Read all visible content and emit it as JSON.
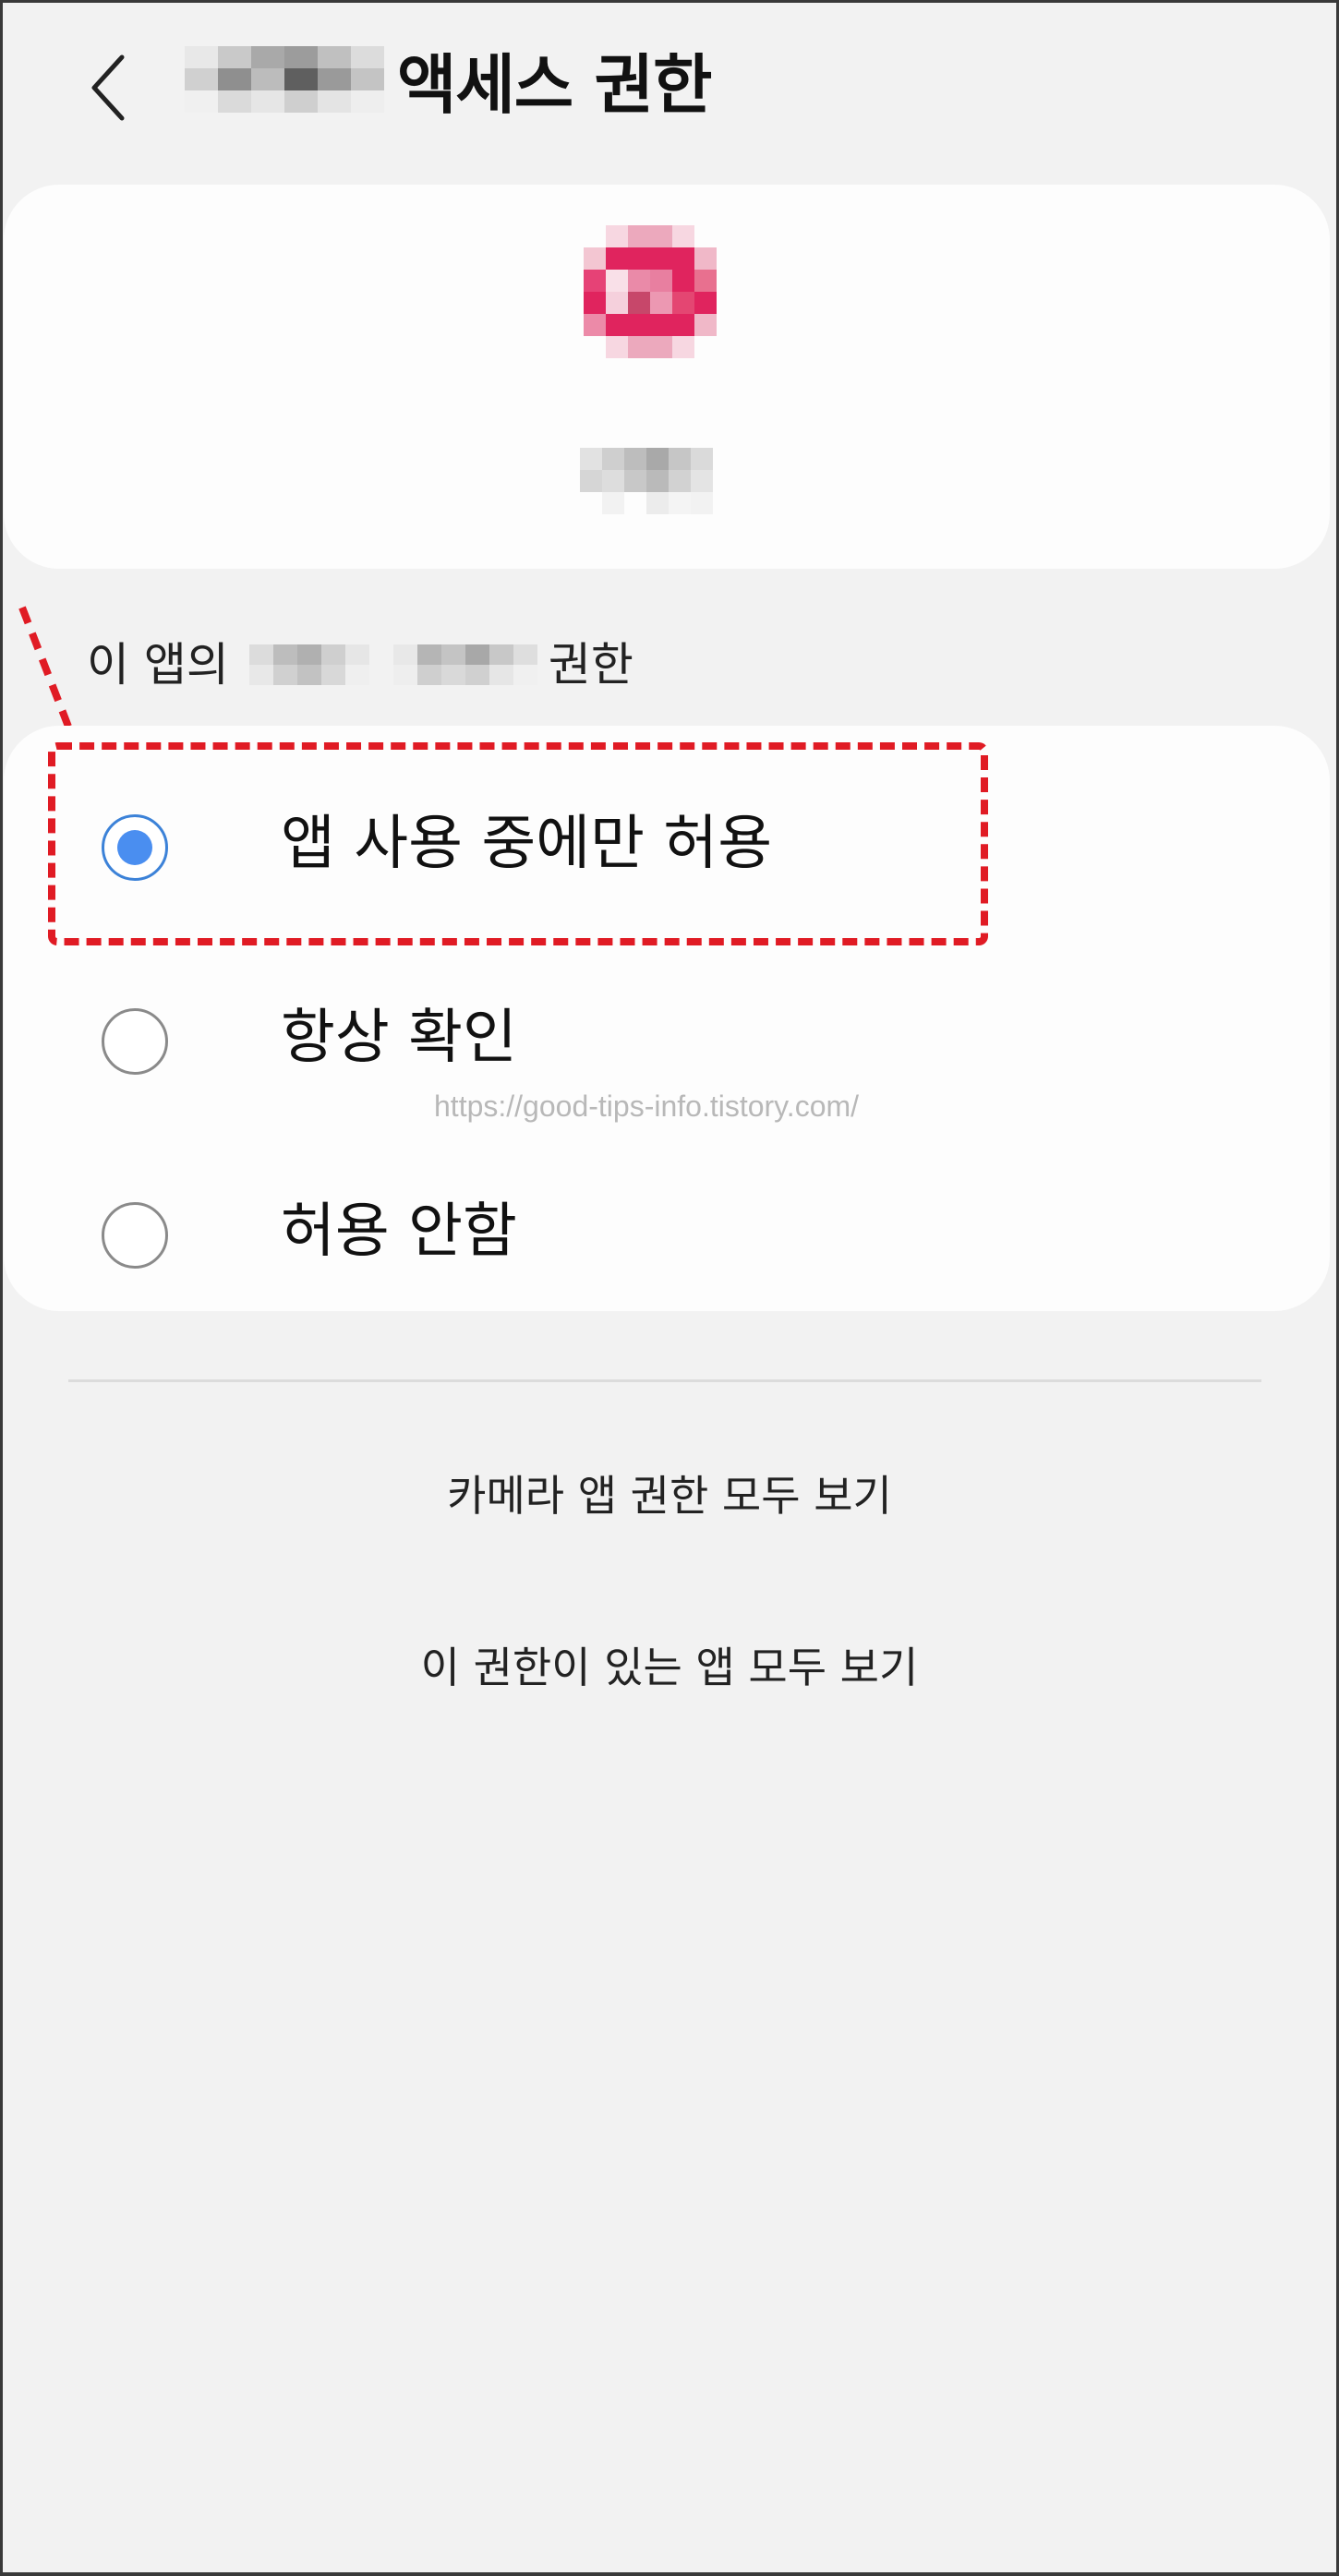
{
  "header": {
    "title": "액세스 권한"
  },
  "section": {
    "prefix": "이 앱의",
    "suffix": "권한"
  },
  "options": [
    {
      "label": "앱 사용 중에만 허용",
      "selected": true
    },
    {
      "label": "항상 확인",
      "selected": false
    },
    {
      "label": "허용 안함",
      "selected": false
    }
  ],
  "watermark": "https://good-tips-info.tistory.com/",
  "links": {
    "camera_permissions": "카메라 앱 권한 모두 보기",
    "apps_with_permission": "이 권한이 있는 앱 모두 보기"
  },
  "colors": {
    "accent": "#4a8ef0",
    "annotation": "#e01b24",
    "app_icon": "#e0245e"
  },
  "icons": {
    "back": "chevron-left-icon",
    "arrow": "dashed-arrow-icon"
  }
}
